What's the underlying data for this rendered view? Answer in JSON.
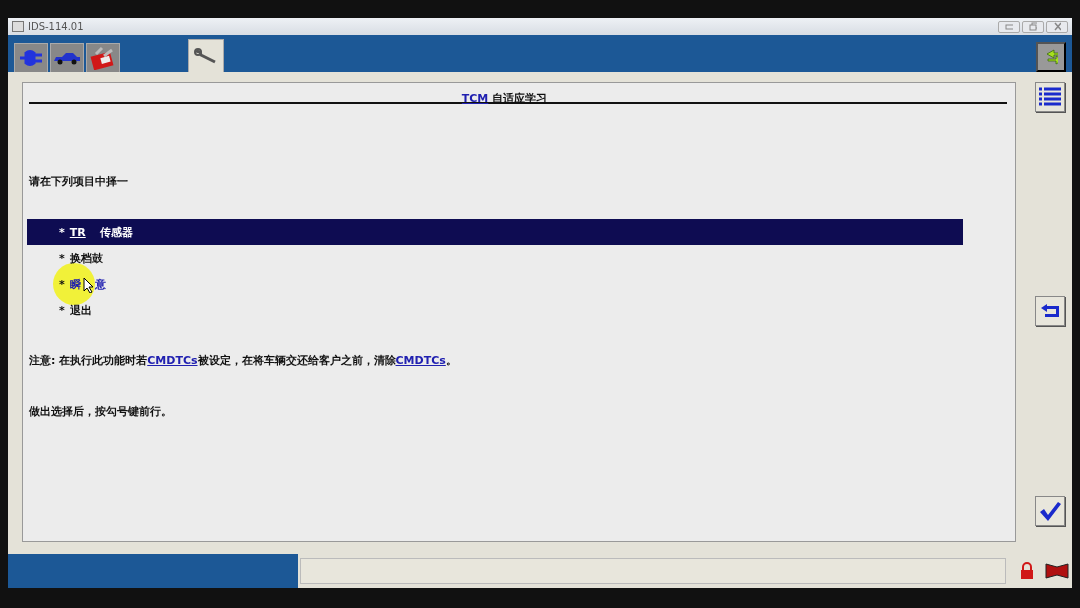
{
  "window": {
    "title": "IDS-114.01"
  },
  "toolbar_tabs": [
    {
      "selected": false
    },
    {
      "selected": false
    },
    {
      "selected": false
    },
    {
      "selected": true
    }
  ],
  "page_title": [
    {
      "text": "TCM",
      "link": true
    },
    {
      "text": " 自适应学习",
      "link": false
    }
  ],
  "prompt": "请在下列项目中择一",
  "items": [
    {
      "bullet": "*",
      "parts": [
        {
          "text": "TR",
          "link": true
        },
        {
          "text": " 传感器",
          "link": false
        }
      ],
      "selected": true
    },
    {
      "bullet": "*",
      "parts": [
        {
          "text": "换档鼓",
          "link": false
        }
      ],
      "selected": false
    },
    {
      "bullet": "*",
      "parts": [
        {
          "text": "瞬",
          "link": false
        },
        {
          "text": "意",
          "link": false
        }
      ],
      "selected": false,
      "cursor": true
    },
    {
      "bullet": "*",
      "parts": [
        {
          "text": "退出",
          "link": false
        }
      ],
      "selected": false
    }
  ],
  "note": [
    {
      "text": "注意: 在执行此功能时若",
      "link": false
    },
    {
      "text": "CMDTCs",
      "link": true
    },
    {
      "text": "被设定，在将车辆交还给客户之前，清除",
      "link": false
    },
    {
      "text": "CMDTCs",
      "link": true
    },
    {
      "text": "。",
      "link": false
    }
  ],
  "instruction": "做出选择后，按勾号键前行。"
}
